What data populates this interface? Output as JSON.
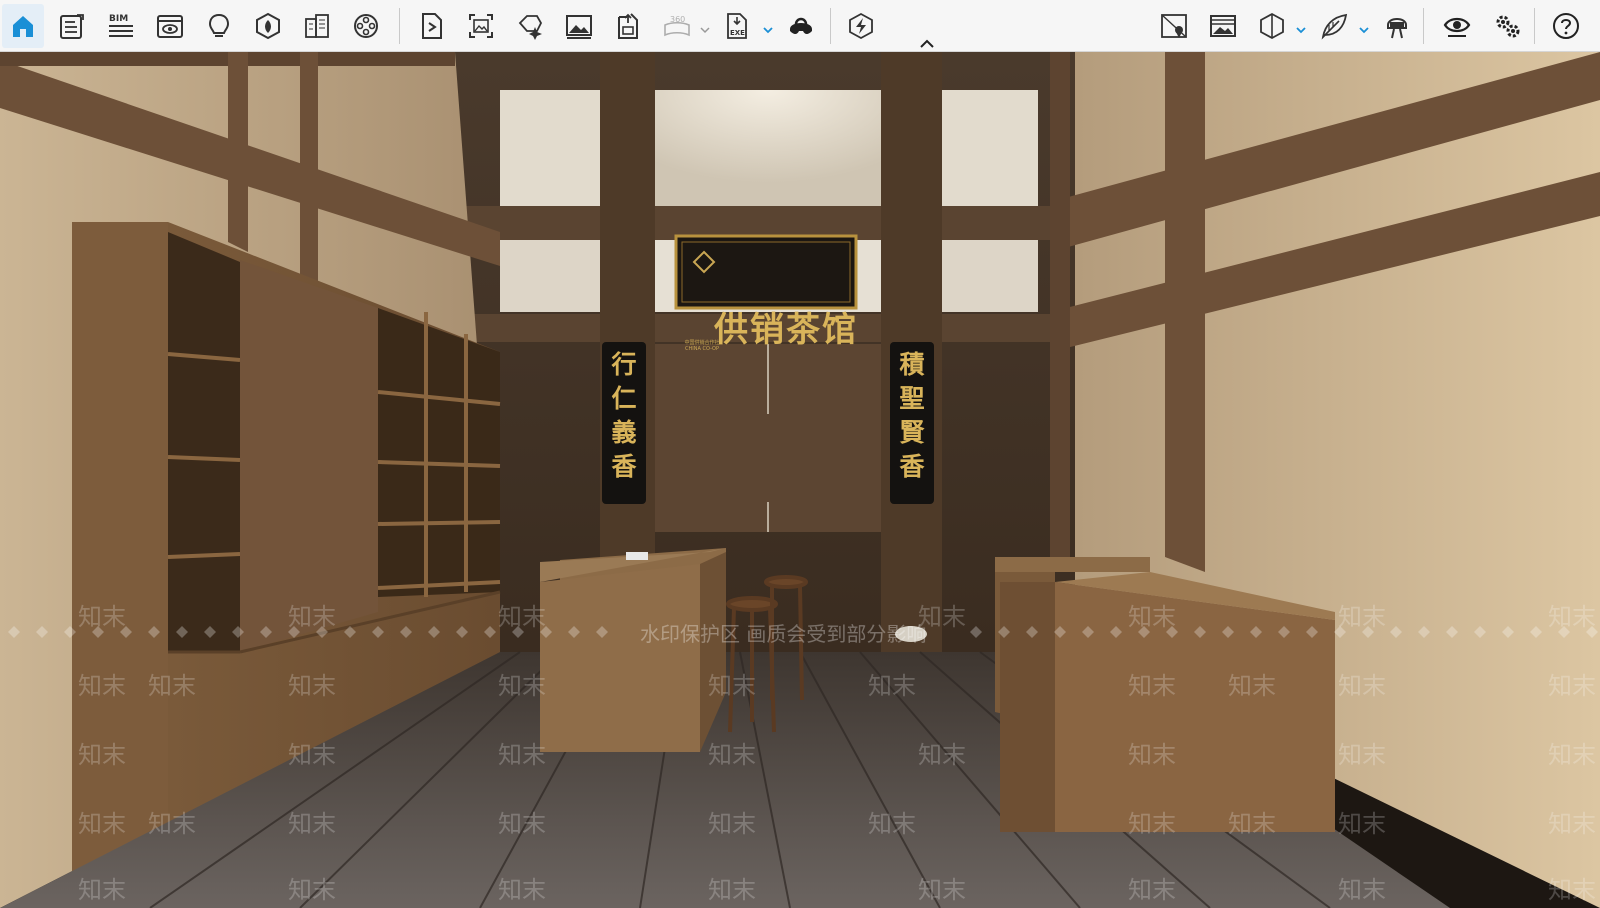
{
  "toolbar": {
    "left_tools": [
      {
        "name": "home",
        "icon": "home-icon",
        "active": true
      },
      {
        "name": "notes",
        "icon": "notes-icon"
      },
      {
        "name": "bim",
        "icon": "bim-icon",
        "label": "BIM"
      },
      {
        "name": "preview-window",
        "icon": "preview-window-icon"
      },
      {
        "name": "lighting",
        "icon": "lightbulb-icon"
      },
      {
        "name": "material",
        "icon": "material-ball-icon"
      },
      {
        "name": "building",
        "icon": "building-icon"
      },
      {
        "name": "video",
        "icon": "film-reel-icon"
      },
      {
        "name": "export-file",
        "icon": "export-file-icon"
      },
      {
        "name": "screenshot",
        "icon": "screenshot-icon"
      },
      {
        "name": "effects",
        "icon": "sparkle-icon"
      },
      {
        "name": "image",
        "icon": "image-icon"
      },
      {
        "name": "export-model",
        "icon": "export-model-icon"
      },
      {
        "name": "panorama-360",
        "icon": "panorama-360-icon",
        "label": "360"
      },
      {
        "name": "exe-export",
        "icon": "exe-export-icon",
        "label": "EXE"
      },
      {
        "name": "vr",
        "icon": "vr-headset-icon"
      },
      {
        "name": "quick-render",
        "icon": "lightning-icon"
      }
    ],
    "right_tools": [
      {
        "name": "map-marker",
        "icon": "map-marker-icon"
      },
      {
        "name": "texture-image",
        "icon": "texture-image-icon"
      },
      {
        "name": "cube-view",
        "icon": "cube-icon"
      },
      {
        "name": "plant",
        "icon": "leaf-icon"
      },
      {
        "name": "walk-mode",
        "icon": "walker-icon"
      },
      {
        "name": "visibility",
        "icon": "eye-icon"
      },
      {
        "name": "settings",
        "icon": "gear-icon"
      },
      {
        "name": "help",
        "icon": "help-icon"
      }
    ],
    "accent_color": "#1a8fd6"
  },
  "scene": {
    "plaque_title": "供销茶馆",
    "plaque_small": "中国供销合作社 CHINA CO-OP",
    "left_couplet": [
      "行",
      "仁",
      "義",
      "香"
    ],
    "right_couplet": [
      "積",
      "聖",
      "賢",
      "香"
    ],
    "watermark_banner": "水印保护区  画质会受到部分影响",
    "watermark_text": "知末"
  }
}
